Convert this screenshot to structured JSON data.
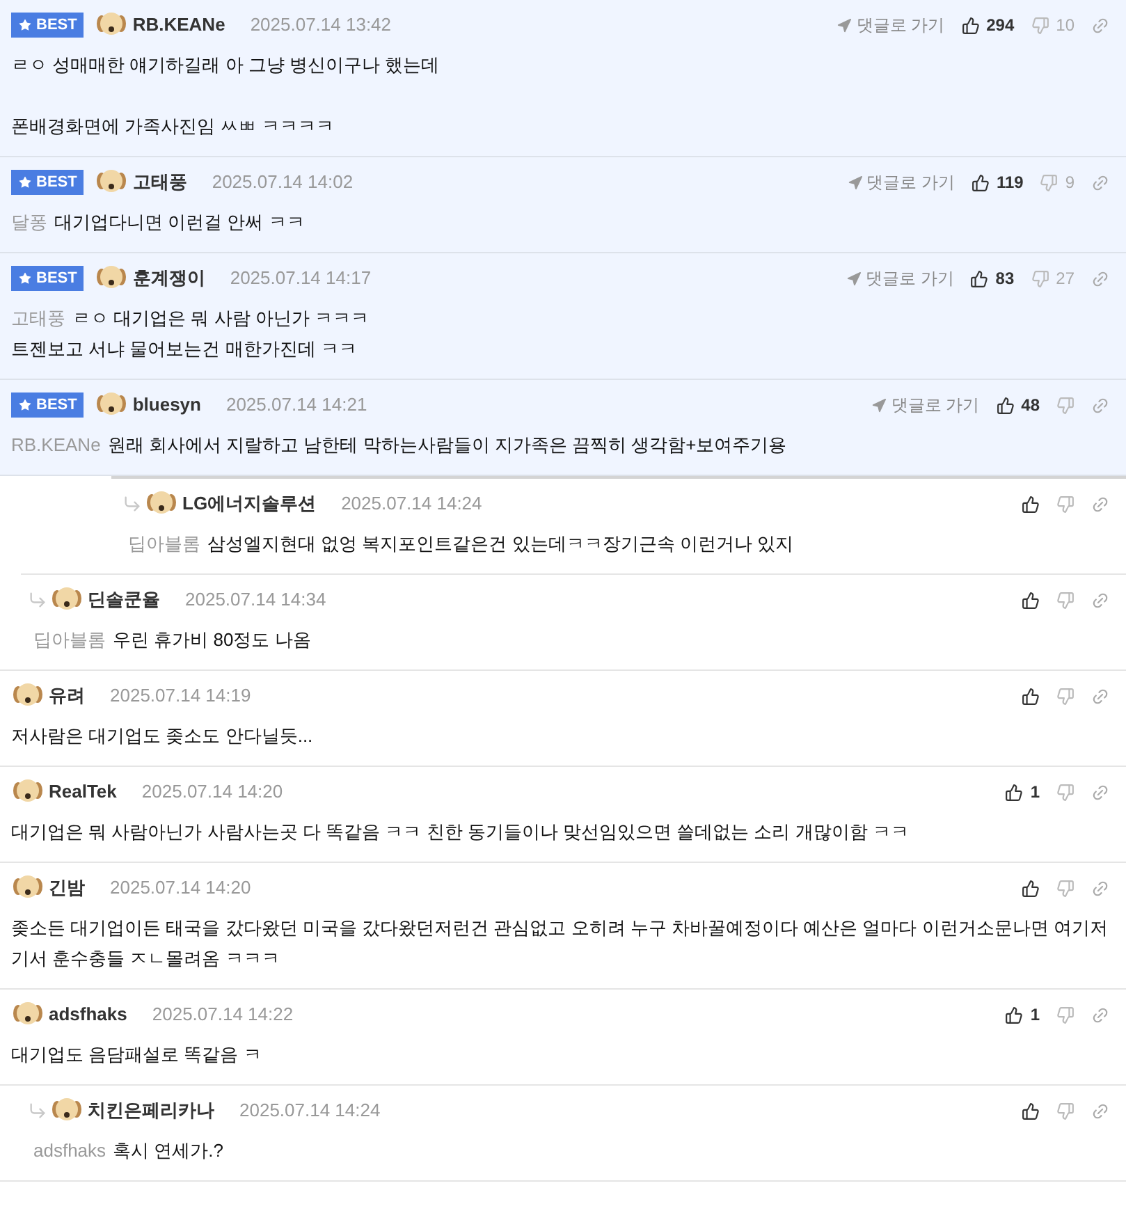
{
  "comments": [
    {
      "kind": "best",
      "badge": "BEST",
      "author": "RB.KEANe",
      "time": "2025.07.14 13:42",
      "goto": "댓글로 가기",
      "likes": "294",
      "dislikes": "10",
      "paragraphs": [
        [
          "ㄹㅇ 성매매한 얘기하길래 아 그냥 병신이구나 했는데"
        ],
        [
          "폰배경화면에 가족사진임 ㅆㅃ ㅋㅋㅋㅋ"
        ]
      ]
    },
    {
      "kind": "best",
      "badge": "BEST",
      "author": "고태풍",
      "time": "2025.07.14 14:02",
      "goto": "댓글로 가기",
      "likes": "119",
      "dislikes": "9",
      "mention": "달퐁",
      "paragraphs": [
        [
          "대기업다니면 이런걸 안써 ㅋㅋ"
        ]
      ]
    },
    {
      "kind": "best",
      "badge": "BEST",
      "author": "훈계쟁이",
      "time": "2025.07.14 14:17",
      "goto": "댓글로 가기",
      "likes": "83",
      "dislikes": "27",
      "mention": "고태풍",
      "paragraphs": [
        [
          "ㄹㅇ 대기업은 뭐 사람 아닌가 ㅋㅋㅋ",
          "트젠보고 서냐 물어보는건 매한가진데 ㅋㅋ"
        ]
      ]
    },
    {
      "kind": "best",
      "badge": "BEST",
      "author": "bluesyn",
      "time": "2025.07.14 14:21",
      "goto": "댓글로 가기",
      "likes": "48",
      "mention": "RB.KEANe",
      "paragraphs": [
        [
          "원래 회사에서 지랄하고 남한테 막하는사람들이 지가족은 끔찍히 생각함+보여주기용"
        ]
      ]
    },
    {
      "kind": "deep_reply",
      "author": "LG에너지솔루션",
      "time": "2025.07.14 14:24",
      "mention": "딥아블롬",
      "paragraphs": [
        [
          "삼성엘지현대 없엉 복지포인트같은건 있는데ㅋㅋ장기근속 이런거나 있지"
        ]
      ]
    },
    {
      "kind": "reply",
      "author": "딘솔쿤율",
      "time": "2025.07.14 14:34",
      "mention": "딥아블롬",
      "paragraphs": [
        [
          "우린 휴가비 80정도 나옴"
        ]
      ]
    },
    {
      "kind": "comment",
      "author": "유려",
      "time": "2025.07.14 14:19",
      "paragraphs": [
        [
          "저사람은 대기업도 좆소도 안다닐듯..."
        ]
      ]
    },
    {
      "kind": "comment",
      "author": "RealTek",
      "time": "2025.07.14 14:20",
      "likes": "1",
      "paragraphs": [
        [
          "대기업은 뭐 사람아닌가 사람사는곳 다 똑같음 ㅋㅋ 친한 동기들이나 맞선임있으면 쓸데없는 소리 개많이함 ㅋㅋ"
        ]
      ]
    },
    {
      "kind": "comment",
      "author": "긴밤",
      "time": "2025.07.14 14:20",
      "paragraphs": [
        [
          "좆소든 대기업이든 태국을 갔다왔던 미국을 갔다왔던저런건 관심없고 오히려 누구 차바꿀예정이다 예산은 얼마다 이런거소문나면 여기저기서 훈수충들 ㅈㄴ몰려옴 ㅋㅋㅋ"
        ]
      ]
    },
    {
      "kind": "comment",
      "author": "adsfhaks",
      "time": "2025.07.14 14:22",
      "likes": "1",
      "paragraphs": [
        [
          "대기업도 음담패설로 똑같음 ㅋ"
        ]
      ]
    },
    {
      "kind": "reply",
      "author": "치킨은페리카나",
      "time": "2025.07.14 14:24",
      "mention": "adsfhaks",
      "paragraphs": [
        [
          "혹시 연세가.?"
        ]
      ]
    }
  ]
}
